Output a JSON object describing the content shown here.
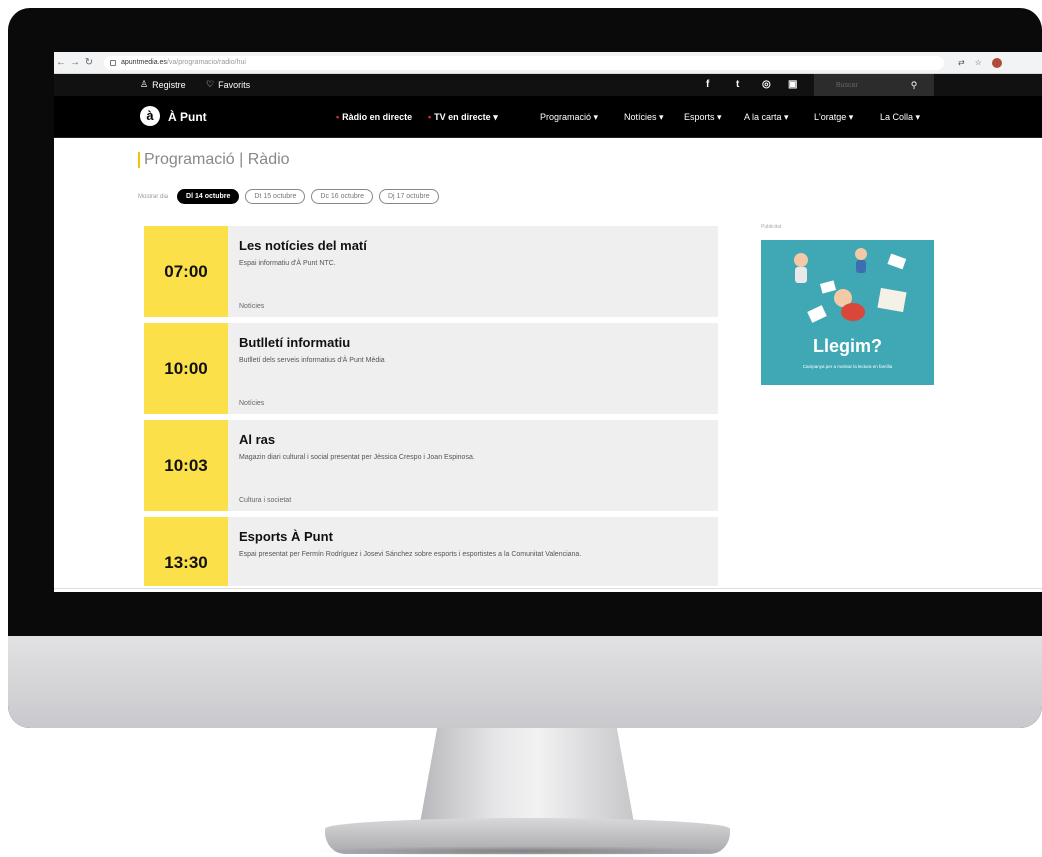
{
  "browser": {
    "url_domain": "apuntmedia.es",
    "url_path": "/va/programacio/radio/hui"
  },
  "topbar": {
    "register_label": "Registre",
    "favorites_label": "Favorits",
    "social": [
      "f",
      "t",
      "◎",
      "▣"
    ],
    "search_placeholder": "Buscar"
  },
  "nav": {
    "logo_letter": "à",
    "logo_text": "À Punt",
    "live_radio": "Ràdio en directe",
    "live_tv": "TV en directe",
    "items": [
      "Programació",
      "Notícies",
      "Esports",
      "A la carta",
      "L'oratge",
      "La Colla"
    ]
  },
  "page": {
    "title": "Programació | Ràdio",
    "filter_label": "Mostrar dia",
    "days": [
      "Dl 14 octubre",
      "Dt 15 octubre",
      "Dc 16 octubre",
      "Dj 17 octubre"
    ],
    "active_day_index": 0
  },
  "schedule": [
    {
      "time": "07:00",
      "title": "Les notícies del matí",
      "description": "Espai informatiu d'À Punt NTC.",
      "category": "Notícies"
    },
    {
      "time": "10:00",
      "title": "Butlletí informatiu",
      "description": "Butlletí dels serveis informatius d'À Punt Mèdia",
      "category": "Notícies"
    },
    {
      "time": "10:03",
      "title": "Al ras",
      "description": "Magazin diari cultural i social presentat per Jèssica Crespo i Joan Espinosa.",
      "category": "Cultura i societat"
    },
    {
      "time": "13:30",
      "title": "Esports À Punt",
      "description": "Espai presentat per Fermín Rodríguez i Josevi Sánchez sobre esports i esportistes a la Comunitat Valenciana.",
      "category": ""
    }
  ],
  "ad": {
    "label": "Publicitat",
    "title": "Llegim?",
    "tagline": "Campanya per a motivar la lectura en família"
  },
  "colors": {
    "accent_yellow": "#fbe04a",
    "nav_black": "#000000",
    "live_red": "#e0322b",
    "ad_teal": "#40a7b5"
  }
}
